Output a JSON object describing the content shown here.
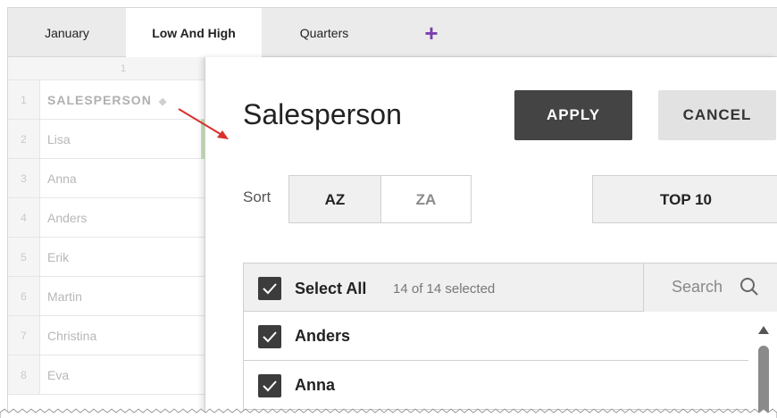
{
  "tabs": [
    {
      "label": "January",
      "active": false
    },
    {
      "label": "Low And High",
      "active": true
    },
    {
      "label": "Quarters",
      "active": false
    }
  ],
  "add_tab_label": "+",
  "sheet": {
    "column_number": "1",
    "rows": [
      {
        "num": "1",
        "value": "SALESPERSON"
      },
      {
        "num": "2",
        "value": "Lisa"
      },
      {
        "num": "3",
        "value": "Anna"
      },
      {
        "num": "4",
        "value": "Anders"
      },
      {
        "num": "5",
        "value": "Erik"
      },
      {
        "num": "6",
        "value": "Martin"
      },
      {
        "num": "7",
        "value": "Christina"
      },
      {
        "num": "8",
        "value": "Eva"
      }
    ]
  },
  "panel": {
    "title": "Salesperson",
    "apply_label": "APPLY",
    "cancel_label": "CANCEL",
    "sort_label": "Sort",
    "sort_options": [
      "AZ",
      "ZA"
    ],
    "selected_sort": "AZ",
    "top10_label": "TOP 10",
    "select_all_label": "Select All",
    "selected_count": "14 of 14 selected",
    "search_label": "Search",
    "items": [
      {
        "label": "Anders",
        "checked": true
      },
      {
        "label": "Anna",
        "checked": true
      }
    ]
  },
  "colors": {
    "accent_plus": "#7b3fb0",
    "apply_bg": "#444444",
    "arrow": "#d9302c",
    "checkbox": "#3c3c3c"
  },
  "icons": [
    "plus-icon",
    "sort-indicator-icon",
    "checkmark-icon",
    "search-icon",
    "scroll-up-icon"
  ]
}
